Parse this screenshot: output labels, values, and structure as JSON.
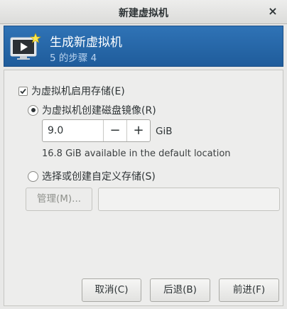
{
  "window": {
    "title": "新建虚拟机",
    "close_glyph": "×"
  },
  "banner": {
    "title": "生成新虚拟机",
    "step": "5 的步骤 4",
    "icon": "monitor-new-vm-icon",
    "colors": {
      "background": "#2a6aaa",
      "step_text": "#b9d3ef"
    }
  },
  "storage": {
    "enable_label": "为虚拟机启用存储(E)",
    "enable_checked": true,
    "create_image_label": "为虚拟机创建磁盘镜像(R)",
    "create_image_selected": true,
    "size_value": "9.0",
    "minus_glyph": "−",
    "plus_glyph": "+",
    "unit": "GiB",
    "available_text": "16.8 GiB available in the default location",
    "custom_label": "选择或创建自定义存储(S)",
    "custom_selected": false,
    "manage_label": "管理(M)...",
    "custom_path_value": ""
  },
  "buttons": {
    "cancel": "取消(C)",
    "back": "后退(B)",
    "forward": "前进(F)"
  }
}
